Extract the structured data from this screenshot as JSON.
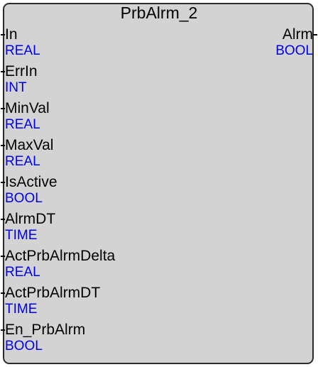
{
  "block": {
    "title": "PrbAlrm_2",
    "inputs": [
      {
        "name": "In",
        "type": "REAL"
      },
      {
        "name": "ErrIn",
        "type": "INT"
      },
      {
        "name": "MinVal",
        "type": "REAL"
      },
      {
        "name": "MaxVal",
        "type": "REAL"
      },
      {
        "name": "IsActive",
        "type": "BOOL"
      },
      {
        "name": "AlrmDT",
        "type": "TIME"
      },
      {
        "name": "ActPrbAlrmDelta",
        "type": "REAL"
      },
      {
        "name": "ActPrbAlrmDT",
        "type": "TIME"
      },
      {
        "name": "En_PrbAlrm",
        "type": "BOOL"
      }
    ],
    "outputs": [
      {
        "name": "Alrm",
        "type": "BOOL"
      }
    ]
  },
  "colors": {
    "block_fill": "#d3d3d3",
    "border": "#2b2b2b",
    "pin_name": "#000000",
    "pin_type": "#0000ee"
  }
}
